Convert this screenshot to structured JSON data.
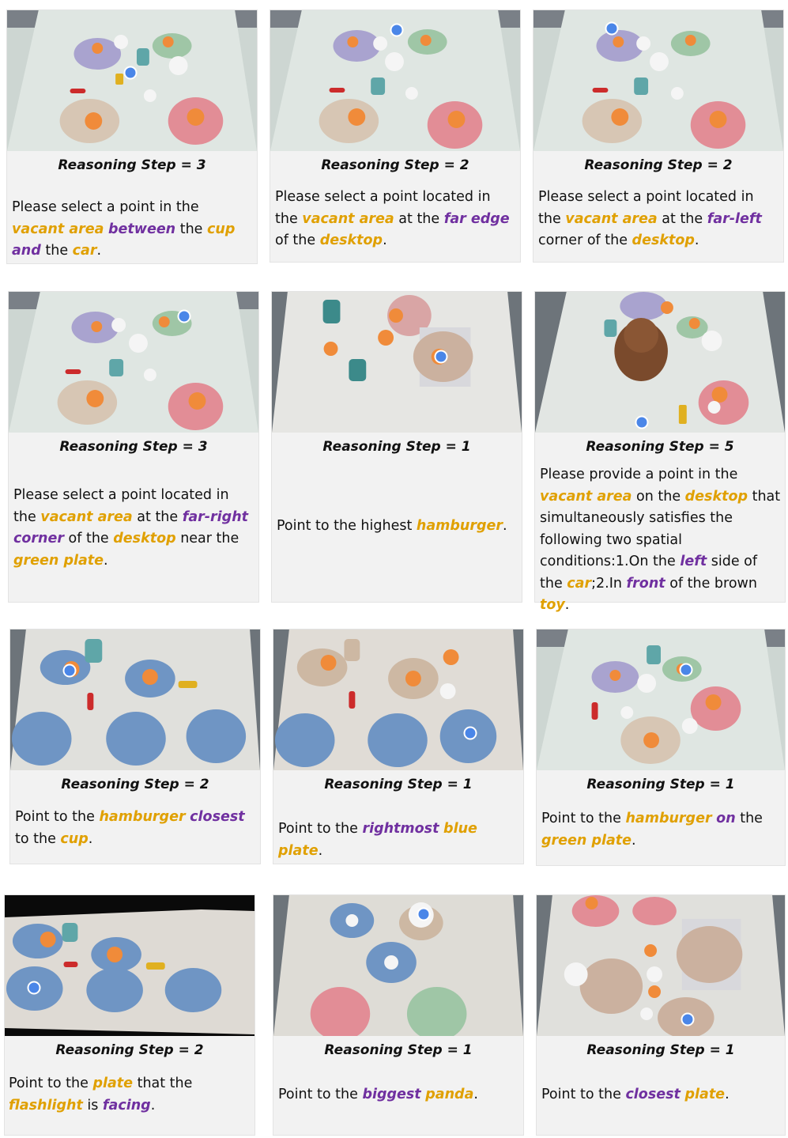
{
  "cards": [
    {
      "step": "Reasoning Step = 3",
      "prompt": [
        [
          "Please select a point in the ",
          ""
        ],
        [
          "vacant area",
          "o"
        ],
        [
          " ",
          ""
        ],
        [
          "between",
          "p"
        ],
        [
          " the ",
          ""
        ],
        [
          "cup",
          "o"
        ],
        [
          " ",
          ""
        ],
        [
          "and",
          "p"
        ],
        [
          " the ",
          ""
        ],
        [
          "car",
          "o"
        ],
        [
          ".",
          ""
        ]
      ]
    },
    {
      "step": "Reasoning Step = 2",
      "prompt": [
        [
          "Please select a point located in the ",
          ""
        ],
        [
          "vacant area",
          "o"
        ],
        [
          " at the ",
          ""
        ],
        [
          "far edge",
          "p"
        ],
        [
          " of the ",
          ""
        ],
        [
          "desktop",
          "o"
        ],
        [
          ".",
          ""
        ]
      ]
    },
    {
      "step": "Reasoning Step = 2",
      "prompt": [
        [
          "Please select a point located in the ",
          ""
        ],
        [
          "vacant area",
          "o"
        ],
        [
          " at the ",
          ""
        ],
        [
          "far-left",
          "p"
        ],
        [
          " corner of the ",
          ""
        ],
        [
          "desktop",
          "o"
        ],
        [
          ".",
          ""
        ]
      ]
    },
    {
      "step": "Reasoning Step = 3",
      "prompt": [
        [
          "Please select a point located in the ",
          ""
        ],
        [
          "vacant area",
          "o"
        ],
        [
          " at the  ",
          ""
        ],
        [
          "far-right corner",
          "p"
        ],
        [
          " of the ",
          ""
        ],
        [
          "desktop",
          "o"
        ],
        [
          " near the ",
          ""
        ],
        [
          "green plate",
          "o"
        ],
        [
          ".",
          ""
        ]
      ]
    },
    {
      "step": "Reasoning Step = 1",
      "prompt": [
        [
          "Point to the highest ",
          ""
        ],
        [
          "hamburger",
          "o"
        ],
        [
          ".",
          ""
        ]
      ]
    },
    {
      "step": "Reasoning Step = 5",
      "prompt": [
        [
          "Please provide a point in the ",
          ""
        ],
        [
          "vacant area",
          "o"
        ],
        [
          " on the ",
          ""
        ],
        [
          "desktop",
          "o"
        ],
        [
          " that simultaneously satisfies the following two spatial conditions:1.On the ",
          ""
        ],
        [
          "left",
          "p"
        ],
        [
          " side of the ",
          ""
        ],
        [
          "car",
          "o"
        ],
        [
          ";2.In ",
          ""
        ],
        [
          "front",
          "p"
        ],
        [
          " of the brown ",
          ""
        ],
        [
          "toy",
          "o"
        ],
        [
          ".",
          ""
        ]
      ]
    },
    {
      "step": "Reasoning Step = 2",
      "prompt": [
        [
          "Point to the ",
          ""
        ],
        [
          "hamburger",
          "o"
        ],
        [
          " ",
          ""
        ],
        [
          "closest",
          "p"
        ],
        [
          " to the ",
          ""
        ],
        [
          "cup",
          "o"
        ],
        [
          ".",
          ""
        ]
      ]
    },
    {
      "step": "Reasoning Step = 1",
      "prompt": [
        [
          "Point to the ",
          ""
        ],
        [
          "rightmost",
          "p"
        ],
        [
          " ",
          ""
        ],
        [
          "blue plate",
          "o"
        ],
        [
          ".",
          ""
        ]
      ]
    },
    {
      "step": "Reasoning Step = 1",
      "prompt": [
        [
          "Point to the ",
          ""
        ],
        [
          "hamburger",
          "o"
        ],
        [
          " ",
          ""
        ],
        [
          "on",
          "p"
        ],
        [
          " the ",
          ""
        ],
        [
          "green plate",
          "o"
        ],
        [
          ".",
          ""
        ]
      ]
    },
    {
      "step": "Reasoning Step = 2",
      "prompt": [
        [
          "Point to the ",
          ""
        ],
        [
          "plate",
          "o"
        ],
        [
          " that the ",
          ""
        ],
        [
          "flashlight",
          "o"
        ],
        [
          " is ",
          ""
        ],
        [
          "facing",
          "p"
        ],
        [
          ".",
          ""
        ]
      ]
    },
    {
      "step": "Reasoning Step = 1",
      "prompt": [
        [
          "Point to the ",
          ""
        ],
        [
          "biggest",
          "p"
        ],
        [
          " ",
          ""
        ],
        [
          "panda",
          "o"
        ],
        [
          ".",
          ""
        ]
      ]
    },
    {
      "step": "Reasoning Step = 1",
      "prompt": [
        [
          "Point to the ",
          ""
        ],
        [
          "closest",
          "p"
        ],
        [
          " ",
          ""
        ],
        [
          "plate",
          "o"
        ],
        [
          ".",
          ""
        ]
      ]
    }
  ],
  "colors": {
    "orange_keyword": "#e0a000",
    "purple_keyword": "#7030a0",
    "marker": "#4a86e8"
  }
}
